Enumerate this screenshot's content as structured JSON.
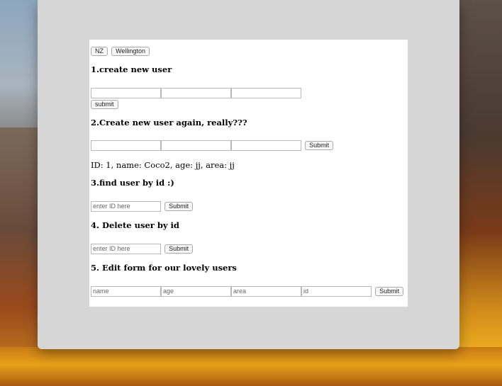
{
  "header_buttons": [
    "NZ",
    "Wellington"
  ],
  "sections": {
    "create": {
      "title": "1.create new user",
      "submit_label": "submit"
    },
    "create_again": {
      "title": "2.Create new user again, really???",
      "submit_label": "Submit",
      "result": "ID: 1, name: Coco2, age: jj, area: jj"
    },
    "find": {
      "title": "3.find user by id :)",
      "placeholder": "enter ID here",
      "submit_label": "Submit"
    },
    "delete": {
      "title": "4. Delete user by id",
      "placeholder": "enter ID here",
      "submit_label": "Submit"
    },
    "edit": {
      "title": "5. Edit form for our lovely users",
      "placeholders": [
        "name",
        "age",
        "area",
        "id"
      ],
      "submit_label": "Submit"
    }
  },
  "colors": {
    "window_bg": "#d6d6d6",
    "content_bg": "#ffffff"
  }
}
